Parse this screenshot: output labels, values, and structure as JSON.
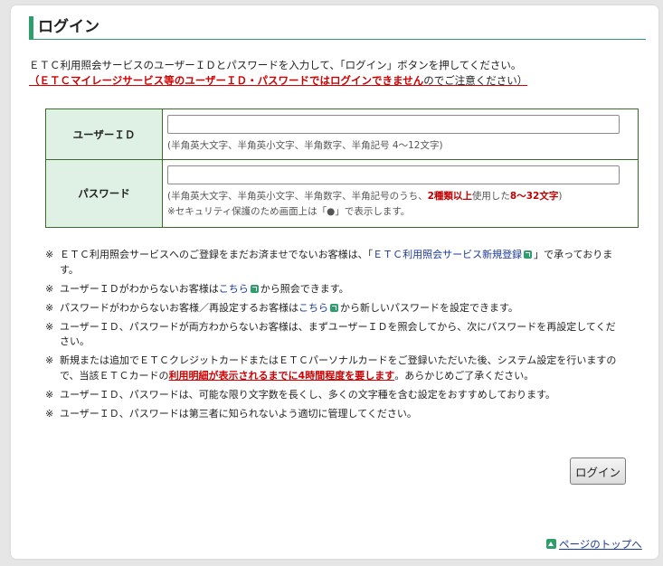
{
  "page": {
    "title": "ログイン",
    "intro": "ＥＴＣ利用照会サービスのユーザーＩＤとパスワードを入力して、「ログイン」ボタンを押してください。",
    "warning_pre": "（ＥＴＣマイレージサービス等のユーザーＩＤ・パスワードではログインできません",
    "warning_post": "のでご注意ください）"
  },
  "form": {
    "userid_label": "ユーザーＩＤ",
    "userid_value": "",
    "userid_hint": "(半角英大文字、半角英小文字、半角数字、半角記号 4～12文字)",
    "password_label": "パスワード",
    "password_value": "",
    "password_hint_pre": "(半角英大文字、半角英小文字、半角数字、半角記号のうち、",
    "password_hint_red1": "2種類以上",
    "password_hint_mid": "使用した",
    "password_hint_red2": "8～32文字",
    "password_hint_post": ")",
    "password_note": "※セキュリティ保護のため画面上は「●」で表示します。"
  },
  "notes": {
    "mark": "※",
    "n1_pre": "ＥＴＣ利用照会サービスへのご登録をまだお済ませでないお客様は、「",
    "n1_link": "ＥＴＣ利用照会サービス新規登録",
    "n1_post": "」で承っております。",
    "n2_pre": "ユーザーＩＤがわからないお客様は",
    "n2_link": "こちら",
    "n2_post": "から照会できます。",
    "n3_pre": "パスワードがわからないお客様／再設定するお客様は",
    "n3_link": "こちら",
    "n3_post": "から新しいパスワードを設定できます。",
    "n4": "ユーザーＩＤ、パスワードが両方わからないお客様は、まずユーザーＩＤを照会してから、次にパスワードを再設定してください。",
    "n5_pre": "新規または追加でＥＴＣクレジットカードまたはＥＴＣパーソナルカードをご登録いただいた後、システム設定を行いますので、当該ＥＴＣカードの",
    "n5_red": "利用明細が表示されるまでに4時間程度を要します",
    "n5_post": "。あらかじめご了承ください。",
    "n6": "ユーザーＩＤ、パスワードは、可能な限り文字数を長くし、多くの文字種を含む設定をおすすめしております。",
    "n7": "ユーザーＩＤ、パスワードは第三者に知られないよう適切に管理してください。"
  },
  "buttons": {
    "login": "ログイン",
    "page_top": "ページのトップへ"
  },
  "icons": {
    "external_link": "external-link-icon",
    "page_top": "arrow-up-icon"
  },
  "colors": {
    "accent_green": "#2e9e6d",
    "label_bg": "#dff1e4",
    "warning_red": "#d00000",
    "link_blue": "#1a3a9a"
  }
}
